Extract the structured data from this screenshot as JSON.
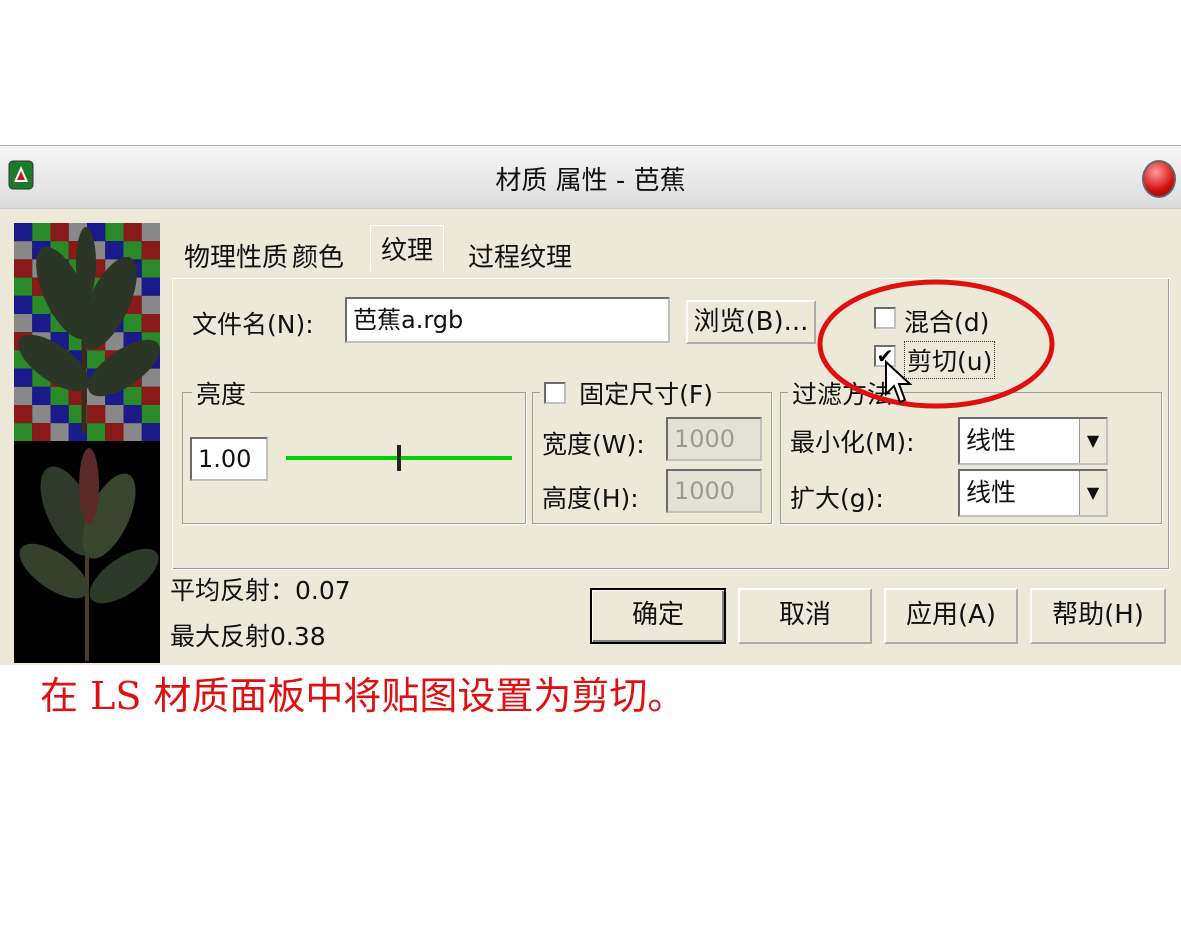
{
  "window": {
    "title": "材质 属性 - 芭蕉"
  },
  "tabs": [
    "物理性质",
    "颜色",
    "纹理",
    "过程纹理"
  ],
  "file": {
    "label": "文件名(N):",
    "value": "芭蕉a.rgb",
    "browse_label": "浏览(B)..."
  },
  "options": {
    "blend_label": "混合(d)",
    "blend_checked": false,
    "clip_label": "剪切(u)",
    "clip_checked": true
  },
  "brightness": {
    "label": "亮度",
    "value": "1.00",
    "level": 0.5
  },
  "fixed_size": {
    "label": "固定尺寸(F)",
    "width_label": "宽度(W):",
    "width_value": "1000",
    "height_label": "高度(H):",
    "height_value": "1000"
  },
  "filter": {
    "label": "过滤方法",
    "minimize_label": "最小化(M):",
    "minimize_value": "线性",
    "magnify_label": "扩大(g):",
    "magnify_value": "线性"
  },
  "stats": {
    "avg_reflect": "平均反射：0.07",
    "max_reflect": "最大反射0.38"
  },
  "buttons": {
    "ok": "确定",
    "cancel": "取消",
    "apply": "应用(A)",
    "help": "帮助(H)"
  },
  "caption": "在 LS 材质面板中将贴图设置为剪切。",
  "colors": {
    "annotation": "#e01010",
    "slider": "#00d000"
  }
}
